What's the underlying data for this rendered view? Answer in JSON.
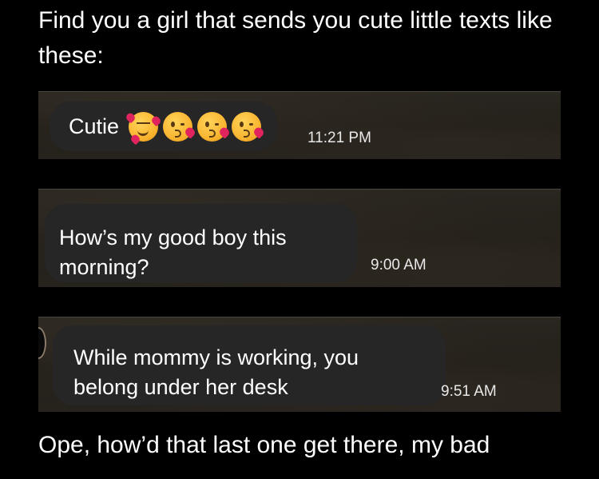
{
  "caption": {
    "top": "Find you a girl that sends you cute little texts like these:",
    "bottom": "Ope, how’d that last one get there, my bad"
  },
  "messages": [
    {
      "text": "Cutie",
      "emojis": [
        "smiling-face-with-hearts-emoji",
        "kissing-heart-emoji",
        "kissing-heart-emoji",
        "kissing-heart-emoji"
      ],
      "time": "11:21 PM"
    },
    {
      "text": "How’s my good boy this morning?",
      "time": "9:00 AM"
    },
    {
      "text": "While mommy is working, you belong under her desk",
      "time": "9:51 AM"
    }
  ],
  "colors": {
    "page_background": "#000000",
    "bubble": "#262626",
    "text": "#ffffff"
  }
}
